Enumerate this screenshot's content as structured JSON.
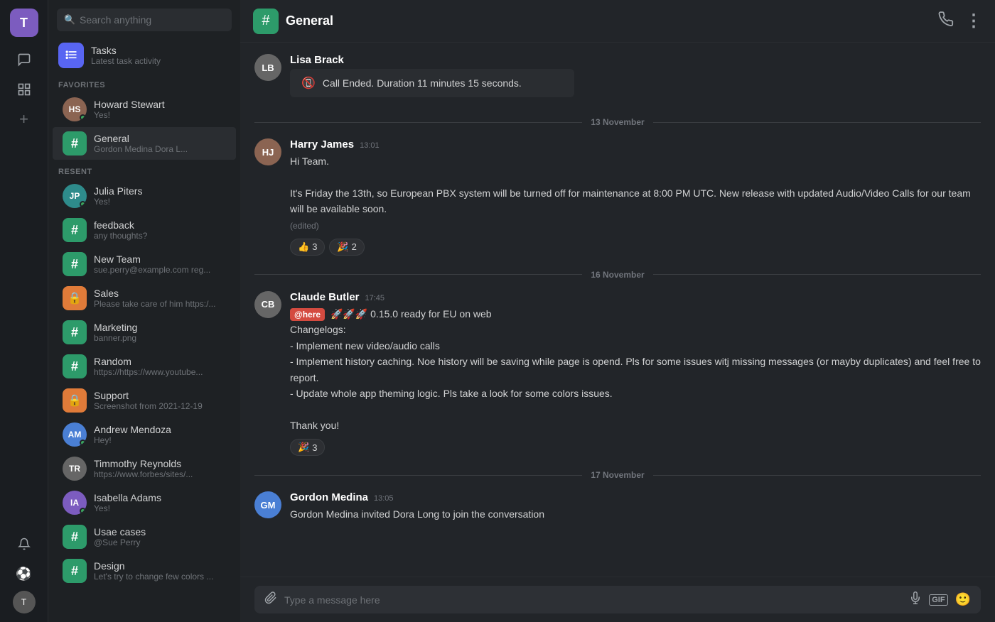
{
  "workspace": {
    "initial": "T"
  },
  "search": {
    "placeholder": "Search anything"
  },
  "tasks": {
    "name": "Tasks",
    "subtitle": "Latest task activity"
  },
  "sections": {
    "favorites": "FAVORITES",
    "resent": "RESENT"
  },
  "favorites": [
    {
      "id": "howard",
      "name": "Howard Stewart",
      "sub": "Yes!",
      "type": "avatar",
      "online": true,
      "initials": "HS",
      "color": "av-brown"
    }
  ],
  "activeChannel": {
    "name": "General",
    "sub": "Gordon Medina Dora L..."
  },
  "resent": [
    {
      "id": "julia",
      "name": "Julia Piters",
      "sub": "Yes!",
      "type": "avatar",
      "online": true,
      "initials": "JP",
      "color": "av-teal"
    },
    {
      "id": "feedback",
      "name": "feedback",
      "sub": "any thoughts?",
      "type": "hash-green",
      "online": false
    },
    {
      "id": "newteam",
      "name": "New Team",
      "sub": "sue.perry@example.com reg...",
      "type": "hash-green",
      "online": false
    },
    {
      "id": "sales",
      "name": "Sales",
      "sub": "Please take care of him https:/...",
      "type": "lock-orange",
      "online": false
    },
    {
      "id": "marketing",
      "name": "Marketing",
      "sub": "banner.png",
      "type": "hash-green",
      "online": false
    },
    {
      "id": "random",
      "name": "Random",
      "sub": "https://https://www.youtube...",
      "type": "hash-green",
      "online": false
    },
    {
      "id": "support",
      "name": "Support",
      "sub": "Screenshot from 2021-12-19",
      "type": "lock-orange",
      "online": false
    },
    {
      "id": "andrew",
      "name": "Andrew Mendoza",
      "sub": "Hey!",
      "type": "avatar",
      "online": true,
      "initials": "AM",
      "color": "av-blue"
    },
    {
      "id": "timmothy",
      "name": "Timmothy Reynolds",
      "sub": "https://www.forbes/sites/...",
      "type": "avatar",
      "online": false,
      "initials": "TR",
      "color": "av-gray"
    },
    {
      "id": "isabella",
      "name": "Isabella Adams",
      "sub": "Yes!",
      "type": "avatar",
      "online": true,
      "initials": "IA",
      "color": "av-purple"
    },
    {
      "id": "usecases",
      "name": "Usae cases",
      "sub": "@Sue Perry",
      "type": "hash-green",
      "online": false
    },
    {
      "id": "design",
      "name": "Design",
      "sub": "Let's try to change few colors ...",
      "type": "hash-green",
      "online": false
    }
  ],
  "chat": {
    "channel_name": "General",
    "call_ended": {
      "text": "Call Ended. Duration 11 minutes 15 seconds."
    },
    "lisa_name": "Lisa Brack",
    "dates": {
      "d1": "13 November",
      "d2": "16  November",
      "d3": "17  November"
    },
    "messages": [
      {
        "id": "msg1",
        "author": "Harry James",
        "time": "13:01",
        "lines": [
          "Hi Team.",
          "",
          "It's Friday the 13th, so European PBX system will be turned off for maintenance at 8:00 PM UTC. New release with updated Audio/Video Calls for our team will be available soon.",
          "(edited)"
        ],
        "reactions": [
          {
            "emoji": "👍",
            "count": "3"
          },
          {
            "emoji": "🎉",
            "count": "2"
          }
        ],
        "initials": "HJ",
        "color": "av-brown"
      },
      {
        "id": "msg2",
        "author": "Claude Butler",
        "time": "17:45",
        "at_here": "@here",
        "lines": [
          "🚀🚀🚀 0.15.0 ready for EU on web",
          "Changelogs:",
          "- Implement new video/audio calls",
          "- Implement history caching. Noe history will be saving while page is opend. Pls for some issues witj missing messages (or mayby duplicates) and  feel free to report.",
          "- Update whole app theming logic. Pls take a look for some colors issues.",
          "",
          "Thank you!"
        ],
        "reactions": [
          {
            "emoji": "🎉",
            "count": "3"
          }
        ],
        "initials": "CB",
        "color": "av-gray"
      },
      {
        "id": "msg3",
        "author": "Gordon Medina",
        "time": "13:05",
        "lines": [
          "Gordon Medina invited Dora Long to join the conversation"
        ],
        "reactions": [],
        "initials": "GM",
        "color": "av-blue"
      }
    ],
    "input_placeholder": "Type a message here"
  },
  "icons": {
    "search": "🔍",
    "tasks_rss": "📋",
    "hash": "#",
    "lock": "🔒",
    "phone": "📞",
    "more": "⋮",
    "attach": "📎",
    "mic": "🎤",
    "gif": "GIF",
    "emoji": "😊",
    "bell": "🔔",
    "soccer": "⚽",
    "add": "+",
    "chat_bubble": "💬",
    "grid": "⊞",
    "call_end": "📵"
  }
}
